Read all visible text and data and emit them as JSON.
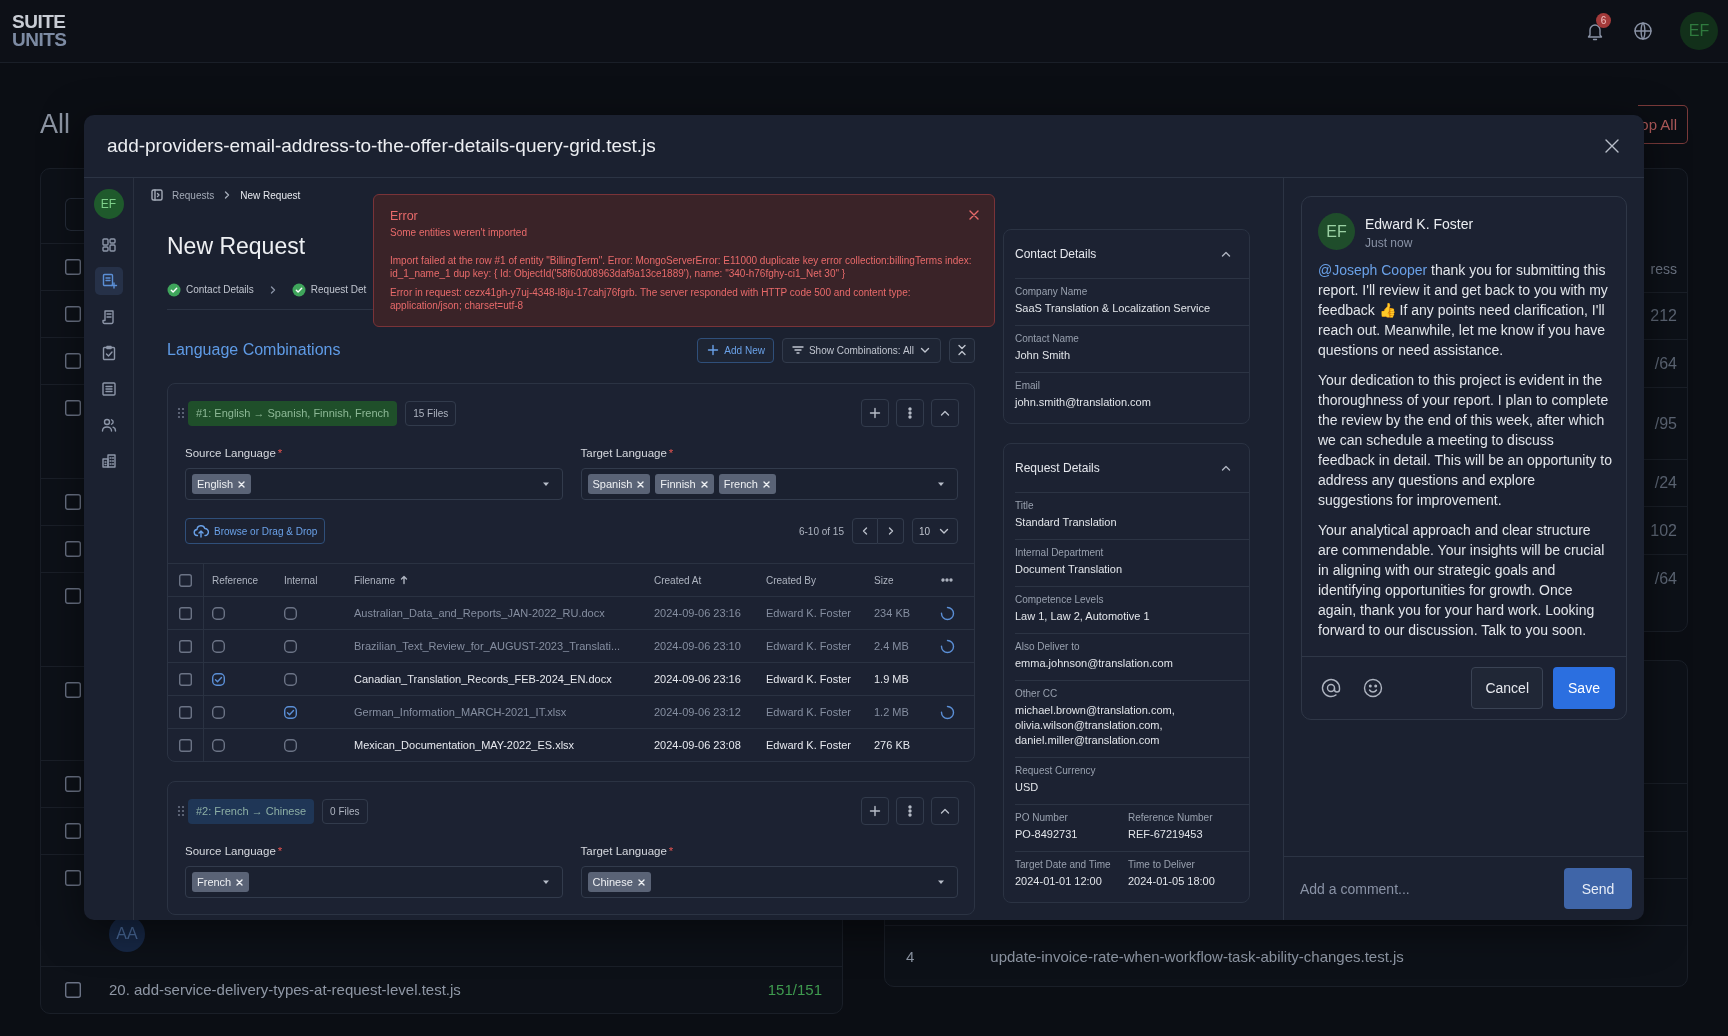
{
  "app": {
    "logo_top": "SUITE",
    "logo_bottom": "UNITS",
    "notifications": "6",
    "avatar": "EF"
  },
  "background": {
    "title": "All",
    "stop_button": "op All",
    "left_rows": [
      {
        "checked": false
      },
      {
        "checked": false
      },
      {
        "checked": false
      },
      {
        "checked": false
      },
      {
        "checked": false
      },
      {
        "checked": false
      },
      {
        "checked": false
      },
      {
        "checked": false
      },
      {
        "checked": false
      },
      {
        "checked": false
      },
      {
        "checked": false,
        "avatar": "AA"
      }
    ],
    "tests": [
      {
        "label": "20. add-service-delivery-types-at-request-level.test.js",
        "count": "151/151",
        "checked": false
      }
    ],
    "progress": [
      "ress",
      "212",
      "/64",
      "/95",
      "/24",
      "102",
      "/64"
    ],
    "runs": [
      {
        "number": "4",
        "file": "update-invoice-rate-when-workflow-task-ability-changes.test.js"
      }
    ]
  },
  "modal": {
    "title": "add-providers-email-address-to-the-offer-details-query-grid.test.js",
    "nav": {
      "avatar": "EF",
      "items": [
        {
          "kind": "grid",
          "selected": false
        },
        {
          "kind": "new-document",
          "selected": true
        },
        {
          "kind": "scroll",
          "selected": false
        },
        {
          "kind": "clipboard",
          "selected": false
        },
        {
          "kind": "list",
          "selected": false
        },
        {
          "kind": "users",
          "selected": false
        },
        {
          "kind": "buildings",
          "selected": false
        }
      ]
    },
    "breadcrumb": [
      "Requests",
      "New Request"
    ],
    "heading": "New Request",
    "steps": [
      {
        "label": "Contact Details",
        "completed": true
      },
      {
        "label": "Request Det",
        "completed": true
      }
    ],
    "error": {
      "title": "Error",
      "subtitle": "Some entities weren't imported",
      "messages": [
        "Import failed at the row #1 of entity \"BillingTerm\". Error: MongoServerError: E11000 duplicate key error collection:billingTerms index: id_1_name_1 dup key: { Id: ObjectId('58f60d08963daf9a13ce1889'), name: \"340-h76fghy-ci1_Net 30\" }",
        "Error in request: cezx41gh-y7uj-4348-l8ju-17cahj76fgrb. The server responded with HTTP code 500 and content type: application/json; charset=utf-8"
      ]
    },
    "section_title": "Language Combinations",
    "add_button": "Add New",
    "filter_button": "Show Combinations: All",
    "combinations": [
      {
        "tag": "#1: English → Spanish, Finnish, French",
        "color": "#1f4f2a",
        "files": "15 Files",
        "source_label": "Source Language",
        "target_label": "Target Language",
        "required_mark": "*",
        "source": [
          "English"
        ],
        "target": [
          "Spanish",
          "Finnish",
          "French"
        ],
        "upload": "Browse or Drag & Drop",
        "range": "6-10 of 15",
        "page_size": "10",
        "table": {
          "all_selected": false,
          "columns": [
            "Reference",
            "Internal",
            "Filename",
            "Created At",
            "Created By",
            "Size"
          ],
          "rows": [
            {
              "selected": false,
              "reference": false,
              "internal": false,
              "filename": "Australian_Data_and_Reports_JAN-2022_RU.docx",
              "created_at": "2024-09-06 23:16",
              "created_by": "Edward K. Foster",
              "size": "234 KB",
              "processing": true
            },
            {
              "selected": false,
              "reference": false,
              "internal": false,
              "filename": "Brazilian_Text_Review_for_AUGUST-2023_Translati...",
              "created_at": "2024-09-06 23:10",
              "created_by": "Edward K. Foster",
              "size": "2.4 MB",
              "processing": true
            },
            {
              "selected": false,
              "reference": true,
              "internal": false,
              "filename": "Canadian_Translation_Records_FEB-2024_EN.docx",
              "created_at": "2024-09-06 23:16",
              "created_by": "Edward K. Foster",
              "size": "1.9 MB",
              "processing": false
            },
            {
              "selected": false,
              "reference": false,
              "internal": true,
              "filename": "German_Information_MARCH-2021_IT.xlsx",
              "created_at": "2024-09-06 23:12",
              "created_by": "Edward K. Foster",
              "size": "1.2 MB",
              "processing": true
            },
            {
              "selected": false,
              "reference": false,
              "internal": false,
              "filename": "Mexican_Documentation_MAY-2022_ES.xlsx",
              "created_at": "2024-09-06 23:08",
              "created_by": "Edward K. Foster",
              "size": "276 KB",
              "processing": false
            }
          ]
        }
      },
      {
        "tag": "#2: French → Chinese",
        "color": "#1f3656",
        "files": "0 Files",
        "source_label": "Source Language",
        "target_label": "Target Language",
        "required_mark": "*",
        "source": [
          "French"
        ],
        "target": [
          "Chinese"
        ]
      }
    ],
    "contact": {
      "title": "Contact Details",
      "expanded": true,
      "fields": [
        [
          {
            "label": "Company Name",
            "value": "SaaS Translation & Localization Service"
          }
        ],
        [
          {
            "label": "Contact Name",
            "value": "John Smith"
          }
        ],
        [
          {
            "label": "Email",
            "value": "john.smith@translation.com"
          }
        ]
      ]
    },
    "request": {
      "title": "Request Details",
      "expanded": true,
      "fields": [
        [
          {
            "label": "Title",
            "value": "Standard Translation"
          }
        ],
        [
          {
            "label": "Internal Department",
            "value": "Document Translation"
          }
        ],
        [
          {
            "label": "Competence Levels",
            "value": "Law 1, Law 2, Automotive 1"
          }
        ],
        [
          {
            "label": "Also Deliver to",
            "value": "emma.johnson@translation.com"
          }
        ],
        [
          {
            "label": "Other CC",
            "value": "michael.brown@translation.com, olivia.wilson@translation.com, daniel.miller@translation.com"
          }
        ],
        [
          {
            "label": "Request Currency",
            "value": "USD"
          }
        ],
        [
          {
            "label": "PO Number",
            "value": "PO-8492731"
          },
          {
            "label": "Reference Number",
            "value": "REF-67219453"
          }
        ],
        [
          {
            "label": "Target Date and Time",
            "value": "2024-01-01 12:00"
          },
          {
            "label": "Time to Deliver",
            "value": "2024-01-05 18:00"
          }
        ]
      ]
    },
    "comment": {
      "avatar": "EF",
      "author": "Edward K. Foster",
      "time": "Just now",
      "mention": "@Joseph Cooper",
      "paragraphs": [
        "thank you for submitting this report. I'll review it and get back to you with my feedback 👍 If any points need clarification, I'll reach out. Meanwhile, let me know if you have questions or need assistance.",
        "Your dedication to this project is evident in the thoroughness of your report. I plan to complete the review by the end of this week, after which we can schedule a meeting to discuss feedback in detail. This will be an opportunity to address any questions and explore suggestions for improvement.",
        "Your analytical approach and clear structure are commendable. Your insights will be crucial in aligning with our strategic goals and identifying opportunities for growth. Once again, thank you for your hard work. Looking forward to our discussion. Talk to you soon."
      ],
      "cancel": "Cancel",
      "save": "Save"
    },
    "composer": {
      "placeholder": "Add a comment...",
      "send": "Send"
    }
  }
}
